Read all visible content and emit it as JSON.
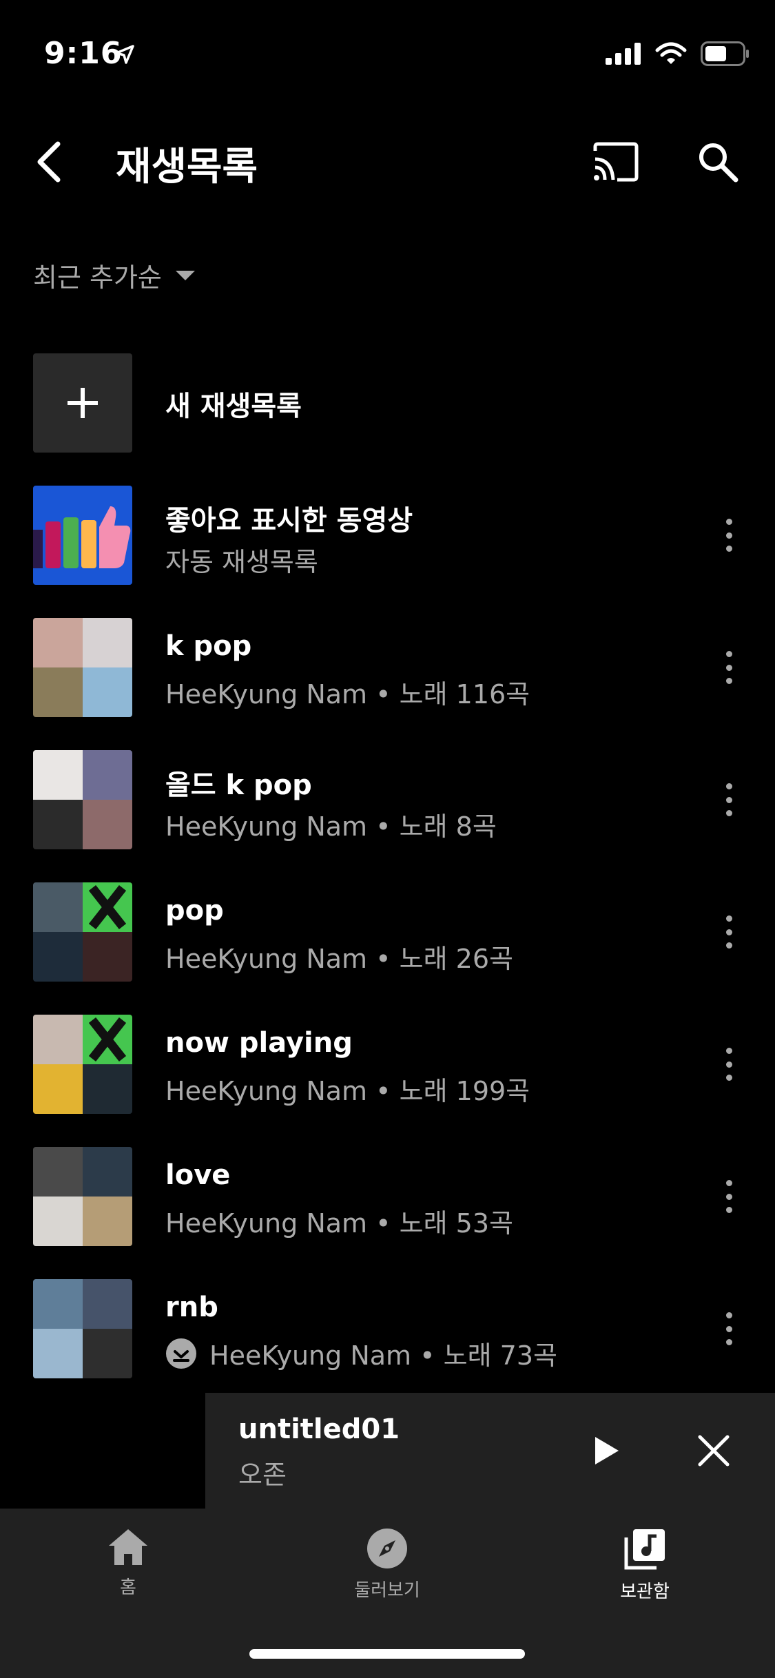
{
  "status": {
    "time": "9:16"
  },
  "header": {
    "title": "재생목록"
  },
  "sort": {
    "label": "최근 추가순"
  },
  "new_playlist": {
    "label": "새 재생목록"
  },
  "playlists": [
    {
      "title": "좋아요 표시한 동영상",
      "subtitle": "자동 재생목록",
      "thumb": "liked"
    },
    {
      "title": "k pop",
      "subtitle": "HeeKyung Nam • 노래 116곡",
      "colors": [
        "#caa59b",
        "#d7d2d3",
        "#8a7c5a",
        "#8fb8d6"
      ]
    },
    {
      "title": "올드 k pop",
      "subtitle": "HeeKyung Nam • 노래 8곡",
      "colors": [
        "#e9e6e4",
        "#6e6d94",
        "#2b2b2b",
        "#8d6a6a"
      ]
    },
    {
      "title": "pop",
      "subtitle": "HeeKyung Nam • 노래 26곡",
      "colors": [
        "#4a5a66",
        "#45c64f",
        "#1e2c3a",
        "#3b2424"
      ]
    },
    {
      "title": "now playing",
      "subtitle": "HeeKyung Nam • 노래 199곡",
      "colors": [
        "#c8b9b0",
        "#45c64f",
        "#e2b331",
        "#1f2a33"
      ]
    },
    {
      "title": "love",
      "subtitle": "HeeKyung Nam • 노래 53곡",
      "colors": [
        "#4a4a4a",
        "#2c3b4a",
        "#d9d6d2",
        "#b59d76"
      ]
    },
    {
      "title": "rnb",
      "subtitle": "HeeKyung Nam • 노래 73곡",
      "downloaded": true,
      "colors": [
        "#5f7e99",
        "#46536a",
        "#9ab7cf",
        "#2e2e2e"
      ]
    }
  ],
  "mini_player": {
    "title": "untitled01",
    "artist": "오존"
  },
  "nav": {
    "home": "홈",
    "explore": "둘러보기",
    "library": "보관함"
  },
  "colors": {
    "background": "#000000",
    "surface": "#212121",
    "secondary_text": "#aaaaaa",
    "accent_liked": "#1a56d6"
  }
}
